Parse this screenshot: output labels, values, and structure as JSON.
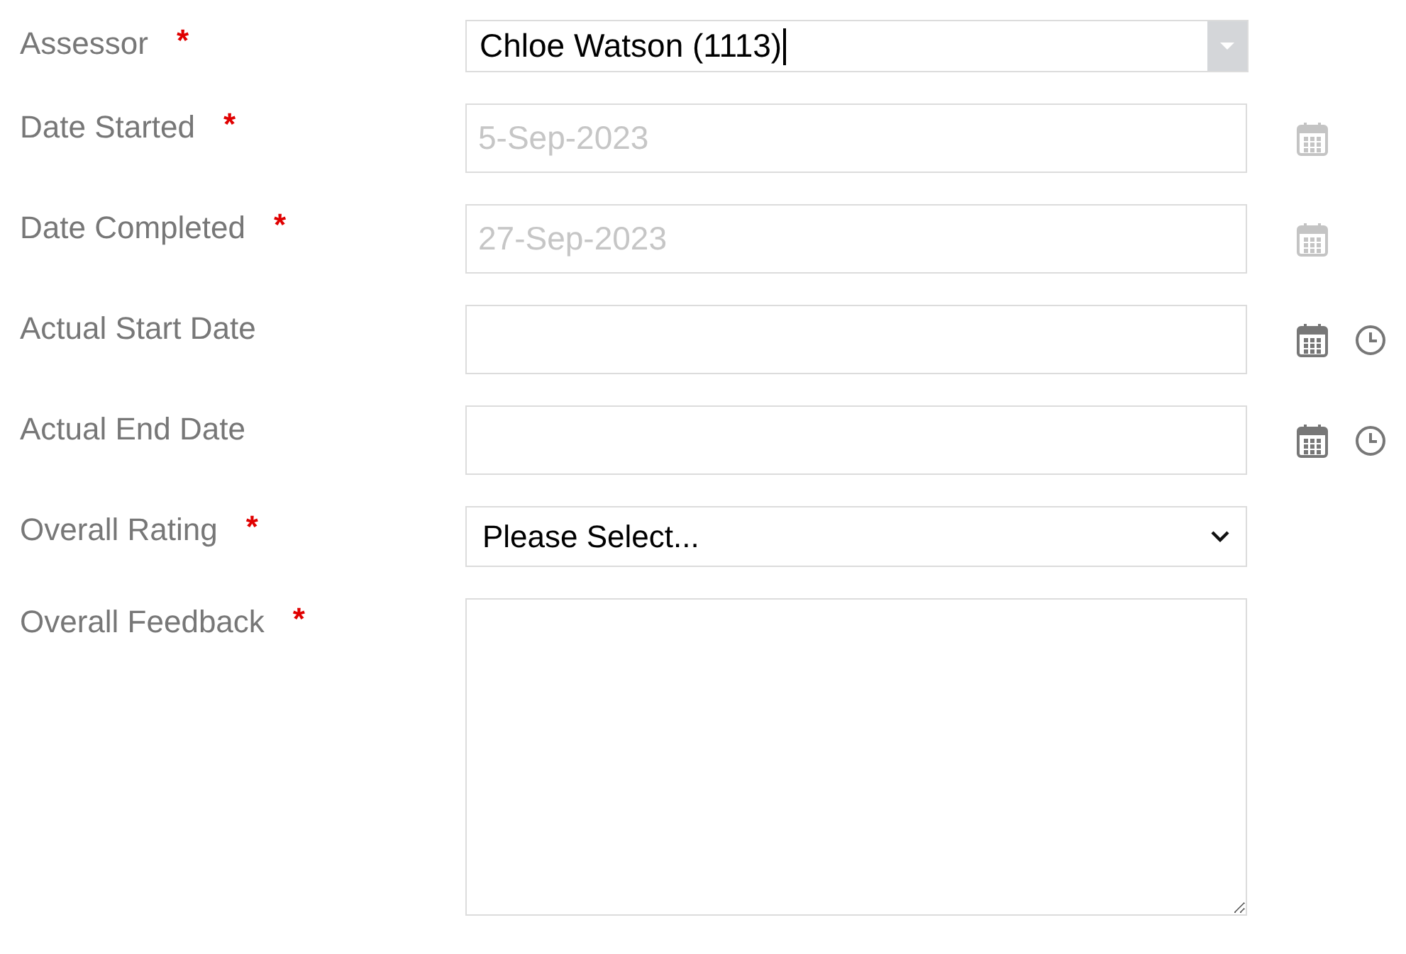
{
  "fields": [
    {
      "kind": "combo",
      "label": "Assessor",
      "required_mark": "*",
      "value": "Chloe Watson (1113)",
      "focused": true
    },
    {
      "kind": "date",
      "label": "Date Started",
      "required_mark": "*",
      "value": "5-Sep-2023",
      "disabled": true,
      "time_picker": false
    },
    {
      "kind": "date",
      "label": "Date Completed",
      "required_mark": "*",
      "value": "27-Sep-2023",
      "disabled": true,
      "time_picker": false
    },
    {
      "kind": "date",
      "label": "Actual Start Date",
      "disabled": false,
      "time_picker": true
    },
    {
      "kind": "date",
      "label": "Actual End Date",
      "disabled": false,
      "time_picker": true
    },
    {
      "kind": "select",
      "label": "Overall Rating",
      "required_mark": "*",
      "value": "Please Select..."
    },
    {
      "kind": "textarea",
      "label": "Overall Feedback",
      "required_mark": "*"
    }
  ]
}
